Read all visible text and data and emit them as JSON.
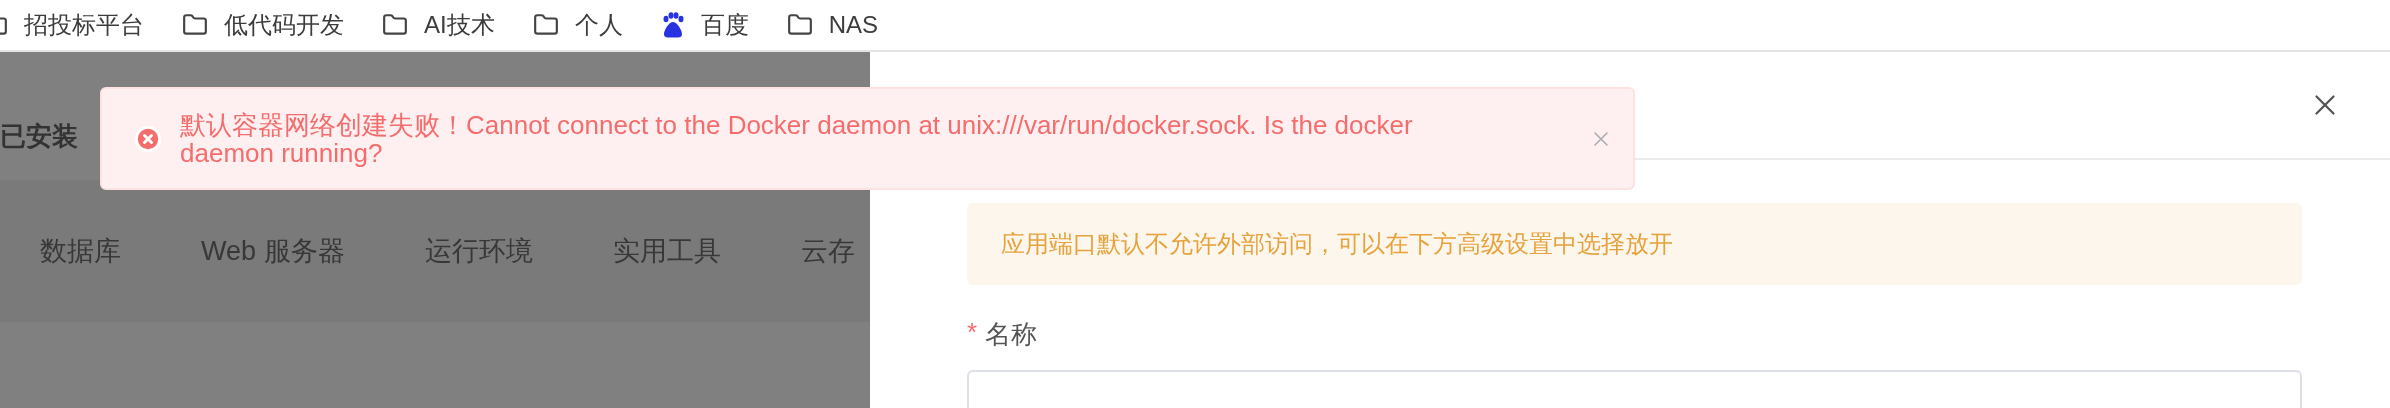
{
  "bookmarks": [
    {
      "kind": "folder",
      "label": "招投标平台"
    },
    {
      "kind": "folder",
      "label": "低代码开发"
    },
    {
      "kind": "folder",
      "label": "AI技术"
    },
    {
      "kind": "folder",
      "label": "个人"
    },
    {
      "kind": "site",
      "label": "百度"
    },
    {
      "kind": "folder",
      "label": "NAS"
    }
  ],
  "page": {
    "installed_label": "已安装",
    "categories": [
      "数据库",
      "Web 服务器",
      "运行环境",
      "实用工具",
      "云存"
    ]
  },
  "toast": {
    "message": "默认容器网络创建失败！Cannot connect to the Docker daemon at unix:///var/run/docker.sock. Is the docker daemon running?"
  },
  "drawer": {
    "alert": {
      "text": "应用端口默认不允许外部访问，可以在下方高级设置中选择放开"
    },
    "fields": [
      {
        "label": "名称",
        "required_mark": "*"
      }
    ]
  }
}
